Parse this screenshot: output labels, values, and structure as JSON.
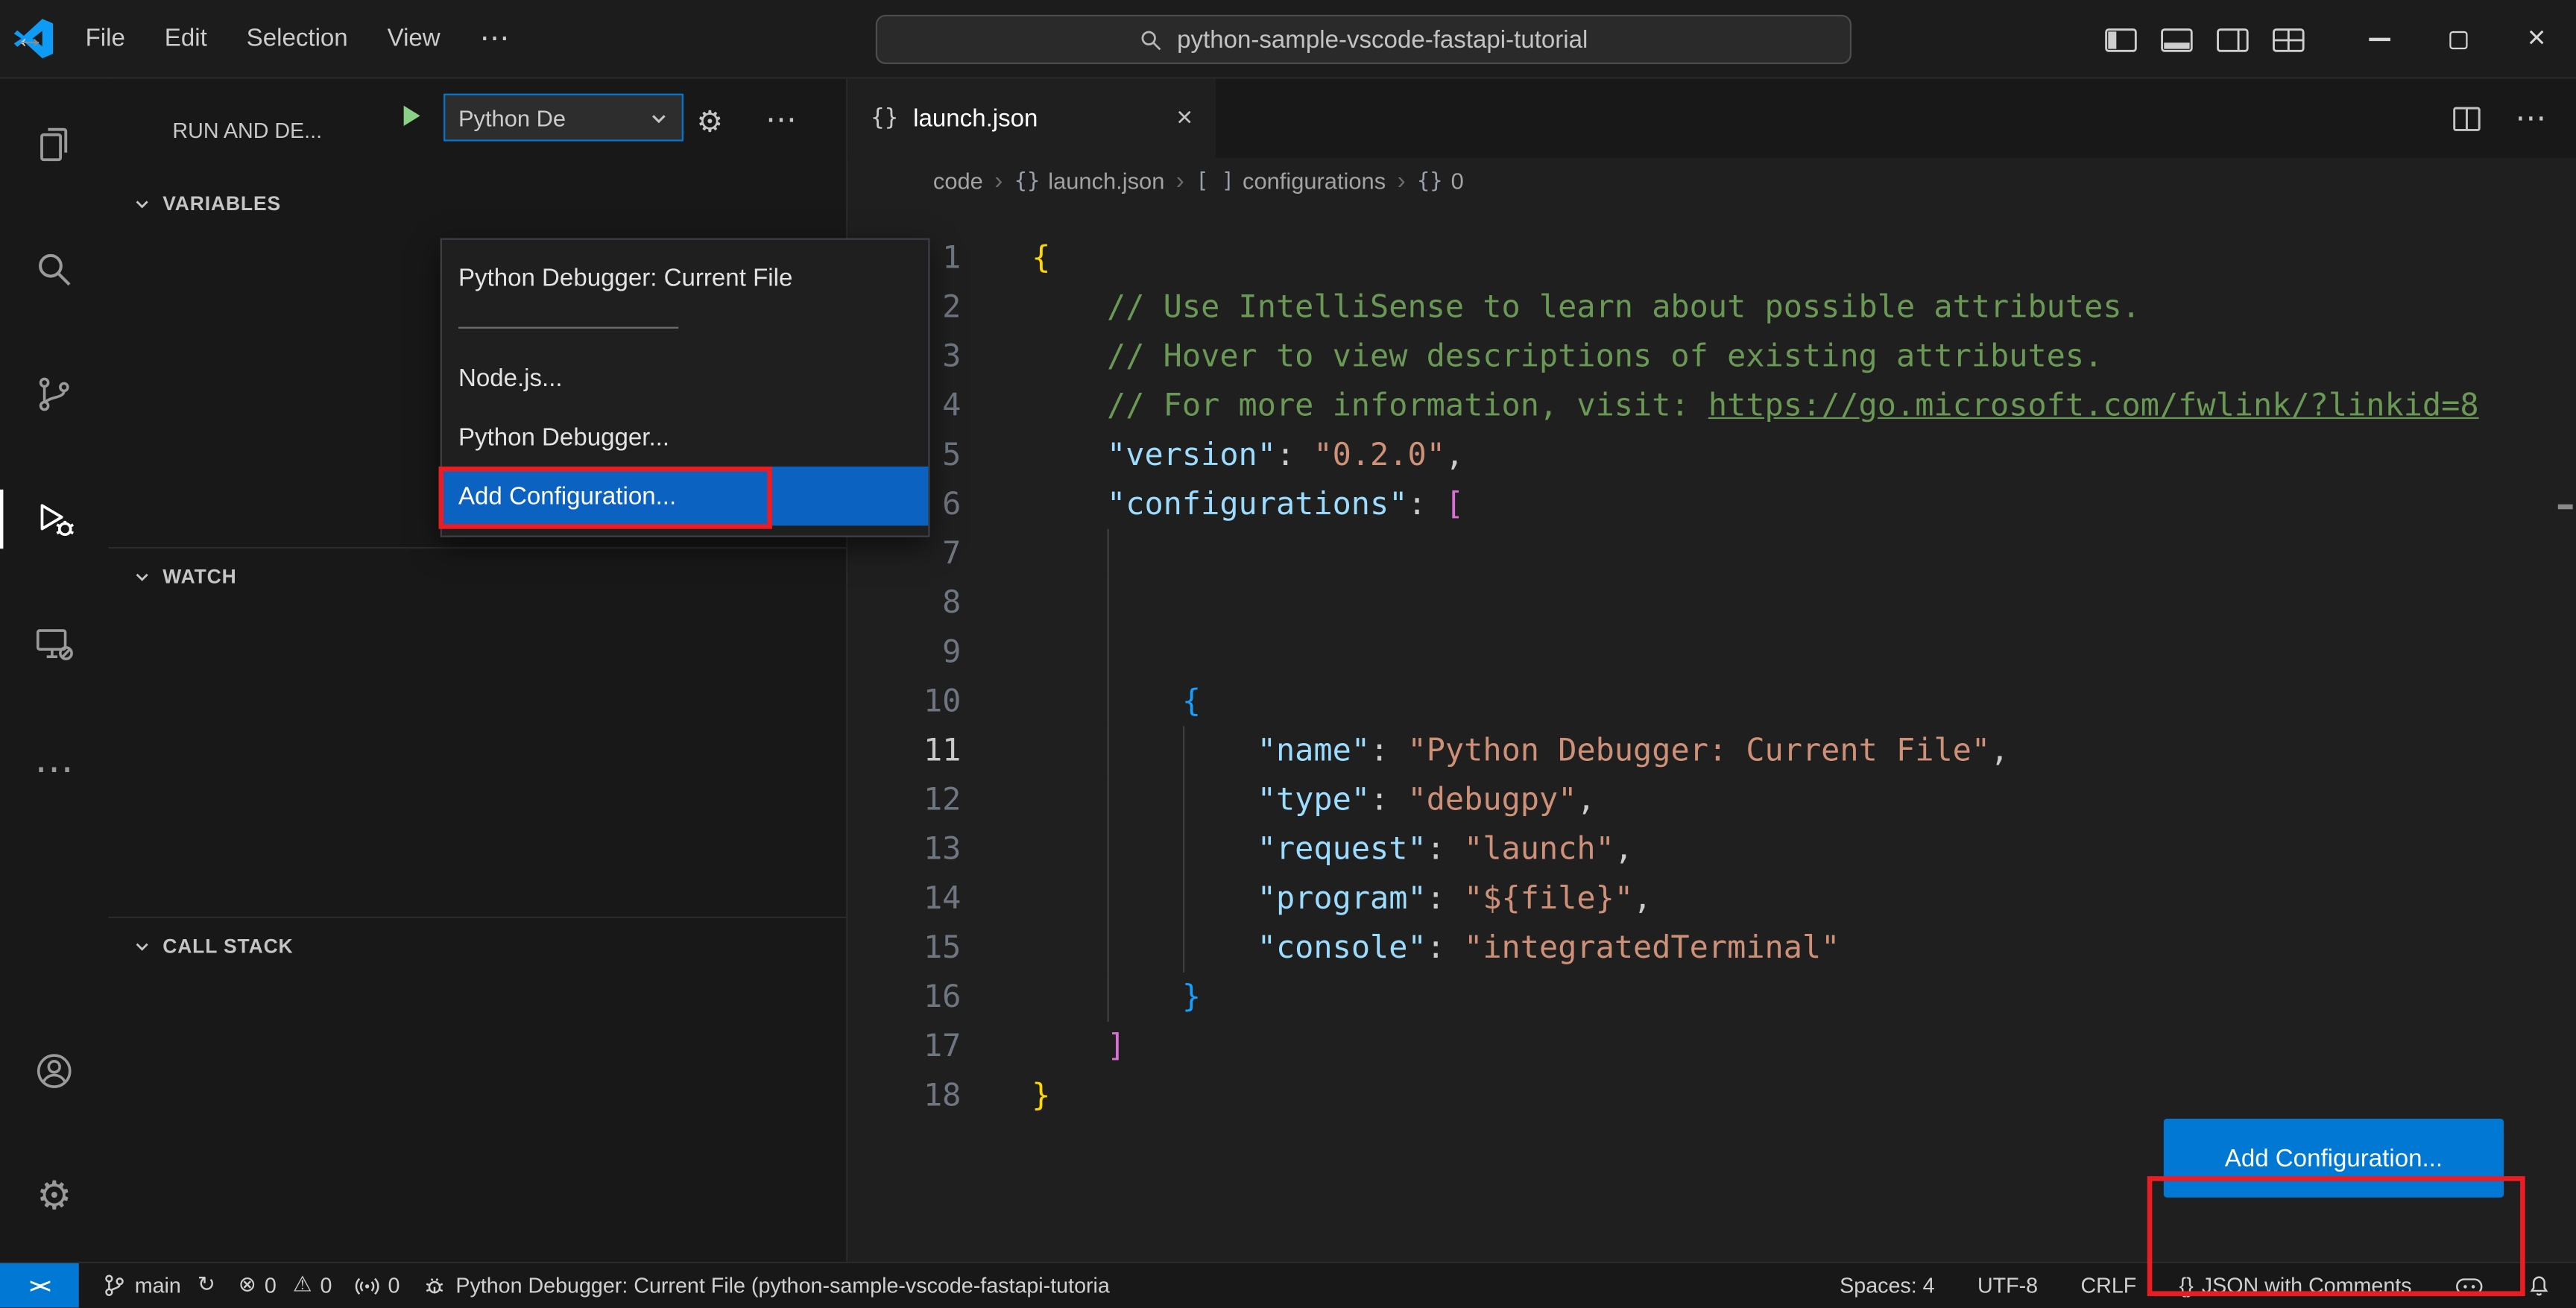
{
  "colors": {
    "accent_blue": "#0078d4",
    "selection_blue": "#0b62c1",
    "button_blue": "#0078d4",
    "annotation_red": "#ea1c24"
  },
  "icons": {
    "more": "⋯",
    "back": "←",
    "forward": "→",
    "gear": "⚙",
    "close": "×",
    "braces": "{}",
    "crumb_sep": "›",
    "sync": "↻",
    "error": "⊗",
    "warning": "⚠"
  },
  "title_bar": {
    "menus": [
      "File",
      "Edit",
      "Selection",
      "View"
    ],
    "search_value": "python-sample-vscode-fastapi-tutorial"
  },
  "activity_bar": {
    "items": [
      {
        "name": "explorer"
      },
      {
        "name": "search"
      },
      {
        "name": "source-control"
      },
      {
        "name": "run-and-debug",
        "active": true
      },
      {
        "name": "remote-explorer"
      },
      {
        "name": "more-actions"
      },
      {
        "name": "account"
      },
      {
        "name": "settings"
      }
    ]
  },
  "sidebar": {
    "title": "RUN AND DE...",
    "debug_dropdown_value": "Python De",
    "sections": [
      {
        "label": "VARIABLES"
      },
      {
        "label": "WATCH"
      },
      {
        "label": "CALL STACK"
      }
    ]
  },
  "debug_config_menu": {
    "current": "Python Debugger: Current File",
    "options": [
      "Node.js...",
      "Python Debugger...",
      "Add Configuration..."
    ],
    "selected_option": "Add Configuration..."
  },
  "editor": {
    "tab": {
      "label": "launch.json"
    },
    "breadcrumbs": [
      {
        "icon": "",
        "label": "code"
      },
      {
        "icon": "{}",
        "label": "launch.json"
      },
      {
        "icon": "[ ]",
        "label": "configurations"
      },
      {
        "icon": "{}",
        "label": "0"
      }
    ],
    "active_line": 11,
    "lines": [
      {
        "n": 1,
        "guides": [],
        "tokens": [
          {
            "t": "{",
            "c": "b1"
          }
        ]
      },
      {
        "n": 2,
        "guides": [],
        "tokens": [
          {
            "t": "    "
          },
          {
            "t": "// Use IntelliSense to learn about possible attributes.",
            "c": "cm"
          }
        ]
      },
      {
        "n": 3,
        "guides": [],
        "tokens": [
          {
            "t": "    "
          },
          {
            "t": "// Hover to view descriptions of existing attributes.",
            "c": "cm"
          }
        ]
      },
      {
        "n": 4,
        "guides": [],
        "tokens": [
          {
            "t": "    "
          },
          {
            "t": "// For more information, visit: ",
            "c": "cm"
          },
          {
            "t": "https://go.microsoft.com/fwlink/?linkid=8",
            "c": "lk"
          }
        ]
      },
      {
        "n": 5,
        "guides": [],
        "tokens": [
          {
            "t": "    "
          },
          {
            "t": "\"version\"",
            "c": "k"
          },
          {
            "t": ": "
          },
          {
            "t": "\"0.2.0\"",
            "c": "s"
          },
          {
            "t": ","
          }
        ]
      },
      {
        "n": 6,
        "guides": [],
        "tokens": [
          {
            "t": "    "
          },
          {
            "t": "\"configurations\"",
            "c": "k"
          },
          {
            "t": ": "
          },
          {
            "t": "[",
            "c": "b2"
          }
        ]
      },
      {
        "n": 7,
        "guides": [
          4
        ],
        "tokens": []
      },
      {
        "n": 8,
        "guides": [
          4
        ],
        "tokens": []
      },
      {
        "n": 9,
        "guides": [
          4
        ],
        "tokens": []
      },
      {
        "n": 10,
        "guides": [
          4
        ],
        "tokens": [
          {
            "t": "        "
          },
          {
            "t": "{",
            "c": "b3"
          }
        ]
      },
      {
        "n": 11,
        "guides": [
          4,
          8
        ],
        "tokens": [
          {
            "t": "            "
          },
          {
            "t": "\"name\"",
            "c": "k"
          },
          {
            "t": ": "
          },
          {
            "t": "\"Python Debugger: Current File\"",
            "c": "s"
          },
          {
            "t": ","
          }
        ]
      },
      {
        "n": 12,
        "guides": [
          4,
          8
        ],
        "tokens": [
          {
            "t": "            "
          },
          {
            "t": "\"type\"",
            "c": "k"
          },
          {
            "t": ": "
          },
          {
            "t": "\"debugpy\"",
            "c": "s"
          },
          {
            "t": ","
          }
        ]
      },
      {
        "n": 13,
        "guides": [
          4,
          8
        ],
        "tokens": [
          {
            "t": "            "
          },
          {
            "t": "\"request\"",
            "c": "k"
          },
          {
            "t": ": "
          },
          {
            "t": "\"launch\"",
            "c": "s"
          },
          {
            "t": ","
          }
        ]
      },
      {
        "n": 14,
        "guides": [
          4,
          8
        ],
        "tokens": [
          {
            "t": "            "
          },
          {
            "t": "\"program\"",
            "c": "k"
          },
          {
            "t": ": "
          },
          {
            "t": "\"${file}\"",
            "c": "s"
          },
          {
            "t": ","
          }
        ]
      },
      {
        "n": 15,
        "guides": [
          4,
          8
        ],
        "tokens": [
          {
            "t": "            "
          },
          {
            "t": "\"console\"",
            "c": "k"
          },
          {
            "t": ": "
          },
          {
            "t": "\"integratedTerminal\"",
            "c": "s"
          }
        ]
      },
      {
        "n": 16,
        "guides": [
          4
        ],
        "tokens": [
          {
            "t": "        "
          },
          {
            "t": "}",
            "c": "b3"
          }
        ]
      },
      {
        "n": 17,
        "guides": [],
        "tokens": [
          {
            "t": "    "
          },
          {
            "t": "]",
            "c": "b2"
          }
        ]
      },
      {
        "n": 18,
        "guides": [],
        "tokens": [
          {
            "t": "}",
            "c": "b1"
          }
        ]
      }
    ],
    "add_configuration_button": "Add Configuration..."
  },
  "status_bar": {
    "remote_label": "><",
    "branch": "main",
    "errors": "0",
    "warnings": "0",
    "ports": "0",
    "debug_status": "Python Debugger: Current File (python-sample-vscode-fastapi-tutoria",
    "spaces": "Spaces: 4",
    "encoding": "UTF-8",
    "eol": "CRLF",
    "language_icon": "{}",
    "language": "JSON with Comments"
  }
}
